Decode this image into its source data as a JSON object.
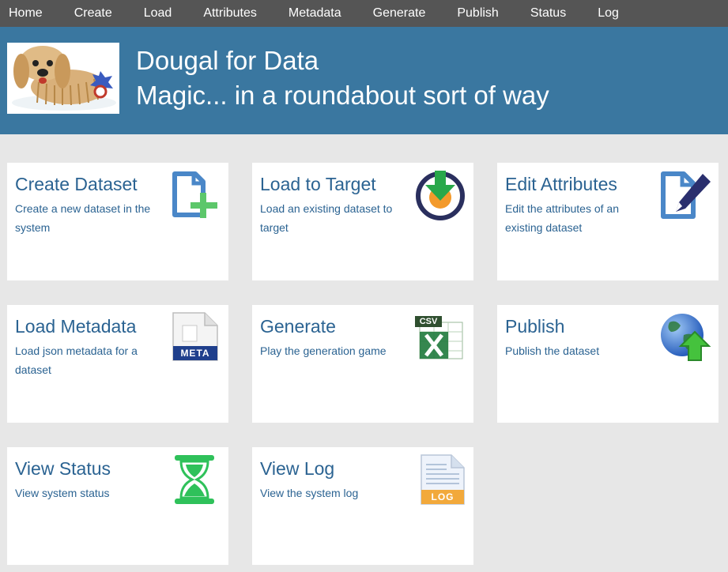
{
  "nav": [
    "Home",
    "Create",
    "Load",
    "Attributes",
    "Metadata",
    "Generate",
    "Publish",
    "Status",
    "Log"
  ],
  "banner": {
    "title": "Dougal for Data",
    "subtitle": "Magic... in a roundabout sort of way"
  },
  "cards": [
    {
      "title": "Create Dataset",
      "desc": "Create a new dataset in the system",
      "icon": "new-document-icon"
    },
    {
      "title": "Load to Target",
      "desc": "Load an existing dataset to target",
      "icon": "download-target-icon"
    },
    {
      "title": "Edit Attributes",
      "desc": "Edit the attributes of an existing dataset",
      "icon": "edit-document-icon"
    },
    {
      "title": "Load Metadata",
      "desc": "Load json metadata for a dataset",
      "icon": "meta-file-icon",
      "icon_label": "META"
    },
    {
      "title": "Generate",
      "desc": "Play the generation game",
      "icon": "csv-excel-icon",
      "icon_label": "CSV"
    },
    {
      "title": "Publish",
      "desc": "Publish the dataset",
      "icon": "globe-upload-icon"
    },
    {
      "title": "View Status",
      "desc": "View system status",
      "icon": "hourglass-icon"
    },
    {
      "title": "View Log",
      "desc": "View the system log",
      "icon": "log-file-icon",
      "icon_label": "LOG"
    }
  ],
  "colors": {
    "nav_bg": "#555555",
    "banner_bg": "#3a77a0",
    "page_bg": "#e7e7e7",
    "link": "#2b6392"
  }
}
